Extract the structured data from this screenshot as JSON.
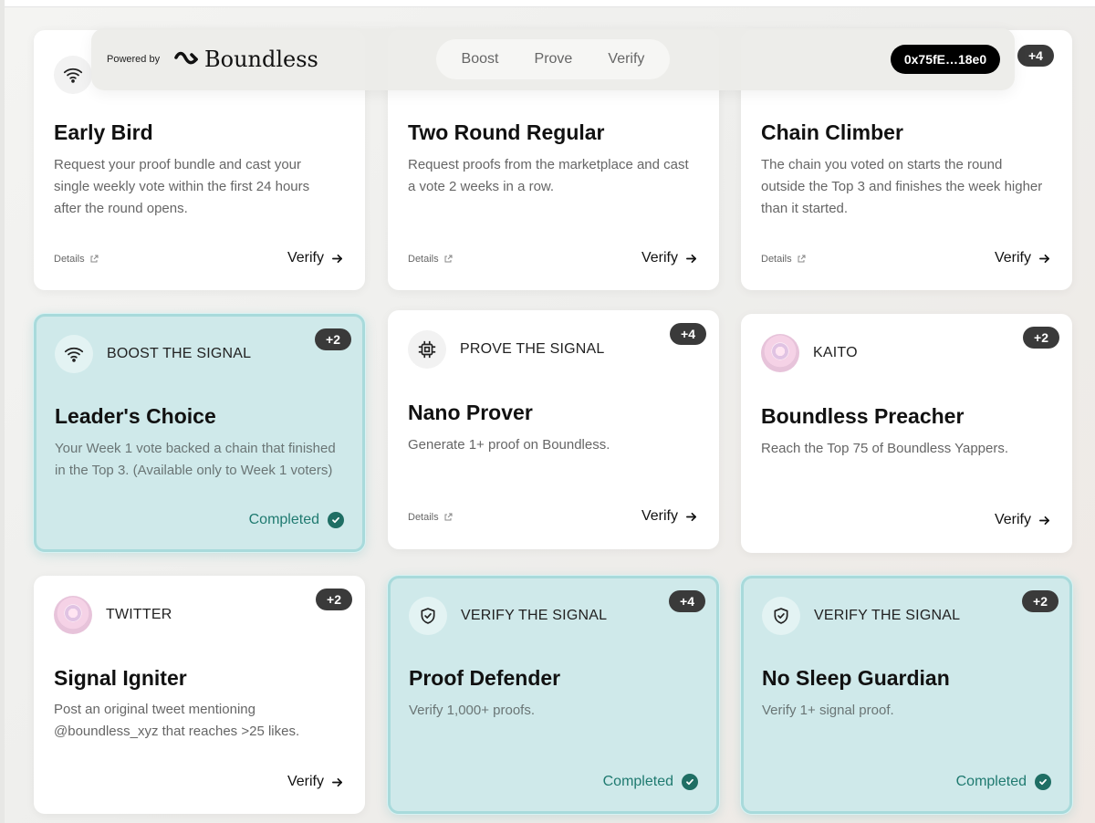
{
  "topbar": {
    "powered_by": "Powered by",
    "brand": "Boundless",
    "nav": [
      "Boost",
      "Prove",
      "Verify"
    ],
    "wallet": "0x75fE…18e0"
  },
  "cards": [
    {
      "title": "Early Bird",
      "description": "Request your proof bundle and cast your single weekly vote within the first 24 hours after the round opens.",
      "details": "Details",
      "action": "Verify"
    },
    {
      "title": "Two Round Regular",
      "description": "Request proofs from the marketplace and cast a vote 2 weeks in a row.",
      "details": "Details",
      "action": "Verify"
    },
    {
      "badge": "+4",
      "title": "Chain Climber",
      "description": "The chain you voted on starts the round outside the Top 3 and finishes the week higher than it started.",
      "details": "Details",
      "action": "Verify"
    },
    {
      "category": "BOOST THE SIGNAL",
      "badge": "+2",
      "title": "Leader's Choice",
      "description": "Your Week 1 vote backed a chain that finished in the Top 3. (Available only to Week 1 voters)",
      "action": "Completed"
    },
    {
      "category": "PROVE THE SIGNAL",
      "badge": "+4",
      "title": "Nano Prover",
      "description": "Generate 1+ proof on Boundless.",
      "details": "Details",
      "action": "Verify"
    },
    {
      "category": "KAITO",
      "badge": "+2",
      "title": "Boundless Preacher",
      "description": "Reach the Top 75 of Boundless Yappers.",
      "action": "Verify"
    },
    {
      "category": "TWITTER",
      "badge": "+2",
      "title": "Signal Igniter",
      "description": "Post an original tweet mentioning @boundless_xyz that reaches >25 likes.",
      "action": "Verify"
    },
    {
      "category": "VERIFY THE SIGNAL",
      "badge": "+4",
      "title": "Proof Defender",
      "description": "Verify 1,000+ proofs.",
      "action": "Completed"
    },
    {
      "category": "VERIFY THE SIGNAL",
      "badge": "+2",
      "title": "No Sleep Guardian",
      "description": "Verify 1+ signal proof.",
      "action": "Completed"
    }
  ],
  "colors": {
    "completed_bg": "#cfe9ea",
    "completed_border": "#a8dadb",
    "completed_text": "#1f7a70",
    "badge_bg": "#3a3a3a"
  },
  "icons": [
    "wifi-icon",
    "chip-icon",
    "shield-check-icon",
    "external-link-icon",
    "arrow-right-icon",
    "check-circle-icon"
  ]
}
